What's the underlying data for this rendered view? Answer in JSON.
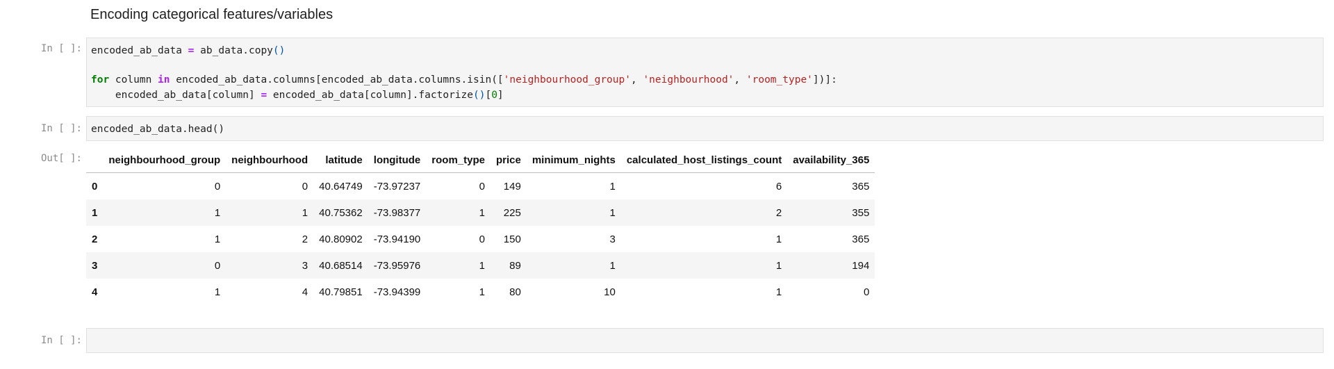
{
  "markdown": {
    "heading": "Encoding categorical features/variables"
  },
  "cells": {
    "cell1": {
      "prompt": "In [ ]:"
    },
    "cell2": {
      "prompt": "In [ ]:",
      "code": "encoded_ab_data.head()"
    },
    "output": {
      "prompt": "Out[ ]:"
    },
    "cell3": {
      "prompt": "In [ ]:"
    }
  },
  "code1": {
    "l1_var": "encoded_ab_data",
    "l1_eq": " = ",
    "l1_rhs": "ab_data.copy",
    "l1_paren": "()",
    "l2_for": "for",
    "l2_mid1": " column ",
    "l2_in": "in",
    "l2_mid2": " encoded_ab_data.columns[encoded_ab_data.columns.isin(",
    "l2_bracket_open": "[",
    "l2_s1": "'neighbourhood_group'",
    "l2_comma1": ", ",
    "l2_s2": "'neighbourhood'",
    "l2_comma2": ", ",
    "l2_s3": "'room_type'",
    "l2_close": "])]:",
    "l3_indent": "    encoded_ab_data[column] ",
    "l3_eq": "=",
    "l3_rhs": " encoded_ab_data[column].factorize",
    "l3_paren": "()",
    "l3_idx_open": "[",
    "l3_zero": "0",
    "l3_idx_close": "]"
  },
  "table": {
    "columns": [
      "",
      "neighbourhood_group",
      "neighbourhood",
      "latitude",
      "longitude",
      "room_type",
      "price",
      "minimum_nights",
      "calculated_host_listings_count",
      "availability_365"
    ],
    "rows": [
      [
        "0",
        "0",
        "0",
        "40.64749",
        "-73.97237",
        "0",
        "149",
        "1",
        "6",
        "365"
      ],
      [
        "1",
        "1",
        "1",
        "40.75362",
        "-73.98377",
        "1",
        "225",
        "1",
        "2",
        "355"
      ],
      [
        "2",
        "1",
        "2",
        "40.80902",
        "-73.94190",
        "0",
        "150",
        "3",
        "1",
        "365"
      ],
      [
        "3",
        "0",
        "3",
        "40.68514",
        "-73.95976",
        "1",
        "89",
        "1",
        "1",
        "194"
      ],
      [
        "4",
        "1",
        "4",
        "40.79851",
        "-73.94399",
        "1",
        "80",
        "10",
        "1",
        "0"
      ]
    ]
  }
}
